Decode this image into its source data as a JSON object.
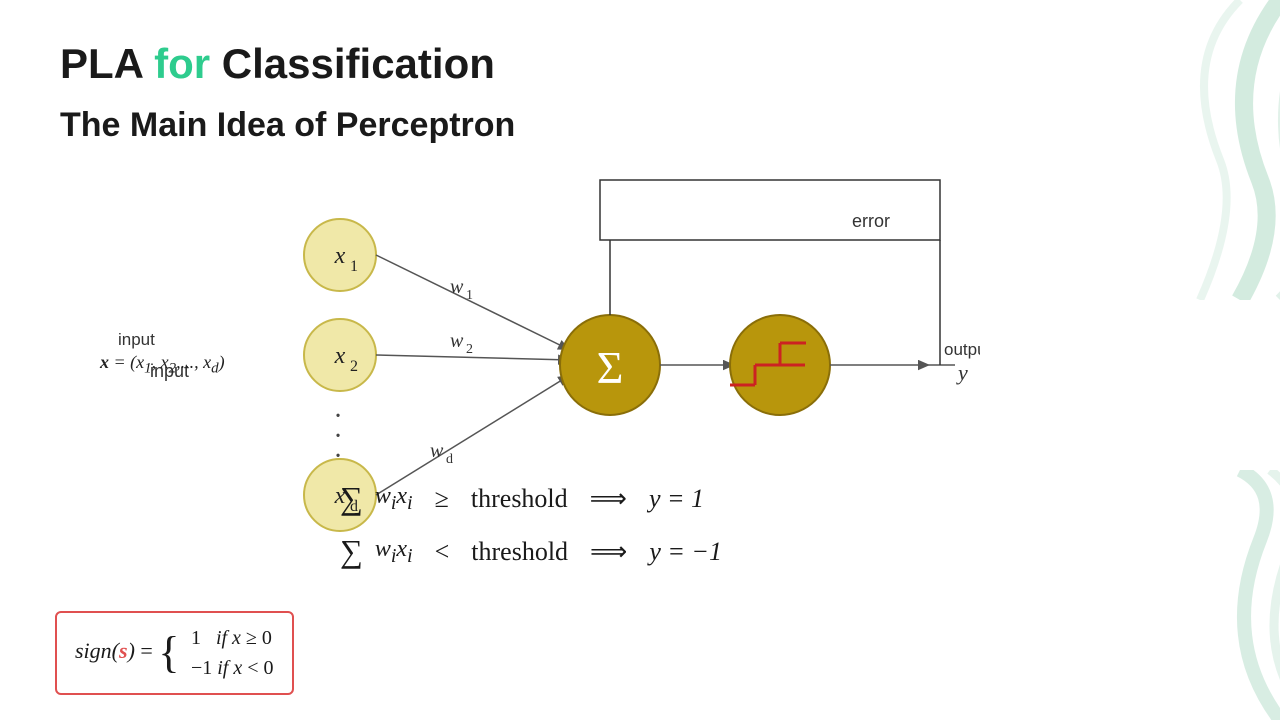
{
  "title": {
    "prefix": "PLA ",
    "for_word": "for",
    "suffix": " Classification"
  },
  "subtitle": "The Main Idea of Perceptron",
  "input": {
    "label": "input",
    "equation": "x = (x₁, x₂,..., x_d)"
  },
  "output": {
    "label": "output",
    "var": "y"
  },
  "error": {
    "label": "error"
  },
  "nodes": {
    "x1": "x₁",
    "x2": "x₂",
    "xd": "x_d",
    "sigma": "Σ"
  },
  "weights": {
    "w1": "w₁",
    "w2": "w₂",
    "wd": "w_d"
  },
  "formulas": {
    "line1": "∑ wᵢxᵢ  ≥  threshold  ⟹  y = 1",
    "line2": "∑ wᵢxᵢ  <  threshold  ⟹  y = −1"
  },
  "sign_box": {
    "text": "sign(s) = { 1  if x ≥ 0 ; −1 if x < 0"
  },
  "colors": {
    "green": "#2ecc8e",
    "gold": "#b8960c",
    "red": "#e05050",
    "text": "#1a1a1a"
  }
}
